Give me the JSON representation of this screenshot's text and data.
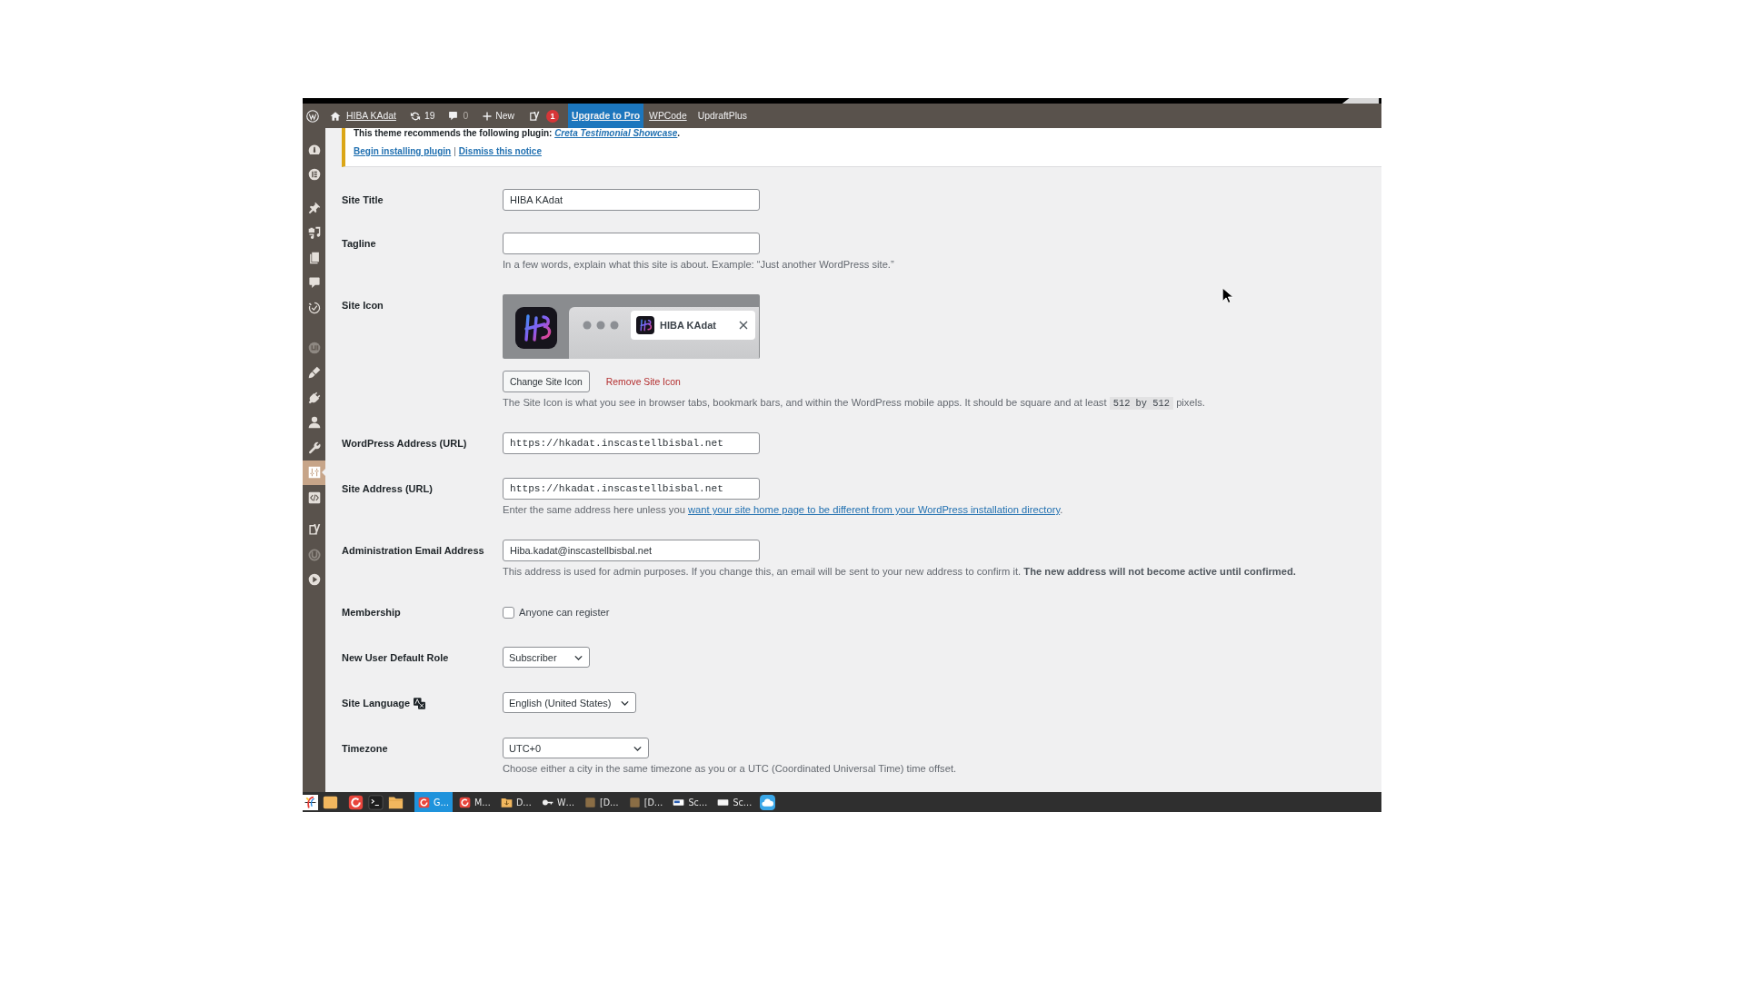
{
  "admin_bar": {
    "items": [
      {
        "kind": "logo"
      },
      {
        "kind": "site",
        "label": "HIBA KAdat",
        "underlined": true
      },
      {
        "kind": "updates",
        "count": "19"
      },
      {
        "kind": "comments",
        "count": "0"
      },
      {
        "kind": "new",
        "label": "New"
      },
      {
        "kind": "seo",
        "badge": "1"
      },
      {
        "kind": "upgrade",
        "label": "Upgrade to Pro",
        "underlined": true
      },
      {
        "kind": "link",
        "label": "WPCode",
        "underlined": true
      },
      {
        "kind": "link",
        "label": "UpdraftPlus",
        "underlined": false
      }
    ]
  },
  "sidebar": {
    "groups": [
      {
        "items": [
          {
            "selected": false
          },
          {
            "selected": false
          }
        ]
      },
      {
        "items": [
          {
            "selected": false
          },
          {
            "selected": false
          },
          {
            "selected": false
          },
          {
            "selected": false
          },
          {
            "selected": false
          }
        ]
      },
      {
        "items": [
          {
            "selected": false
          },
          {
            "selected": false
          },
          {
            "selected": false
          },
          {
            "selected": false
          },
          {
            "selected": false
          },
          {
            "selected": true
          },
          {
            "selected": false
          }
        ]
      },
      {
        "items": [
          {
            "selected": false
          },
          {
            "selected": false
          },
          {
            "selected": false
          }
        ]
      }
    ]
  },
  "notice": {
    "message": "This theme recommends the following plugin:",
    "plugin_link": "Creta Testimonial Showcase",
    "message_end": ".",
    "actions": [
      "Begin installing plugin",
      "Dismiss this notice"
    ],
    "separator": "|"
  },
  "settings": {
    "rows": [
      {
        "kind": "text",
        "label": "Site Title",
        "value": "HIBA KAdat"
      },
      {
        "kind": "text",
        "label": "Tagline",
        "description": "In a few words, explain what this site is about. Example: “Just another WordPress site.”"
      },
      {
        "kind": "site_icon",
        "label": "Site Icon",
        "preview_title": "HIBA KAdat",
        "change_button": "Change Site Icon",
        "remove_link": "Remove Site Icon",
        "description": "The Site Icon is what you see in browser tabs, bookmark bars, and within the WordPress mobile apps. It should be square and at least",
        "description_code": "512 by 512",
        "description_end": "pixels."
      },
      {
        "kind": "url",
        "label": "WordPress Address (URL)",
        "value": "https://hkadat.inscastellbisbal.net"
      },
      {
        "kind": "url",
        "label": "Site Address (URL)",
        "value": "https://hkadat.inscastellbisbal.net",
        "description": "Enter the same address here unless you",
        "description_link": "want your site home page to be different from your WordPress installation directory",
        "description_end": "."
      },
      {
        "kind": "email",
        "label": "Administration Email Address",
        "value": "Hiba.kadat@inscastellbisbal.net",
        "description": "This address is used for admin purposes. If you change this, an email will be sent to your new address to confirm it. **The new address will not become active until confirmed.**"
      },
      {
        "kind": "checkbox",
        "label": "Membership",
        "option": "Anyone can register",
        "checked": false
      },
      {
        "kind": "select",
        "label": "New User Default Role",
        "value": "Subscriber"
      },
      {
        "kind": "select",
        "label": "Site Language",
        "label_icon": true,
        "value": "English (United States)"
      },
      {
        "kind": "select",
        "label": "Timezone",
        "value": "UTC+0",
        "description": "Choose either a city in the same timezone as you or a UTC (Coordinated Universal Time) time offset."
      }
    ]
  },
  "taskbar": {
    "windows": [
      {
        "label": "G…",
        "selected": true
      },
      {
        "label": "M…",
        "selected": false
      },
      {
        "label": "D…",
        "selected": false
      },
      {
        "label": "W…",
        "selected": false
      },
      {
        "label": "[D…",
        "selected": false
      },
      {
        "label": "[D…",
        "selected": false
      },
      {
        "label": "Sc…",
        "selected": false
      },
      {
        "label": "Sc…",
        "selected": false
      }
    ]
  }
}
